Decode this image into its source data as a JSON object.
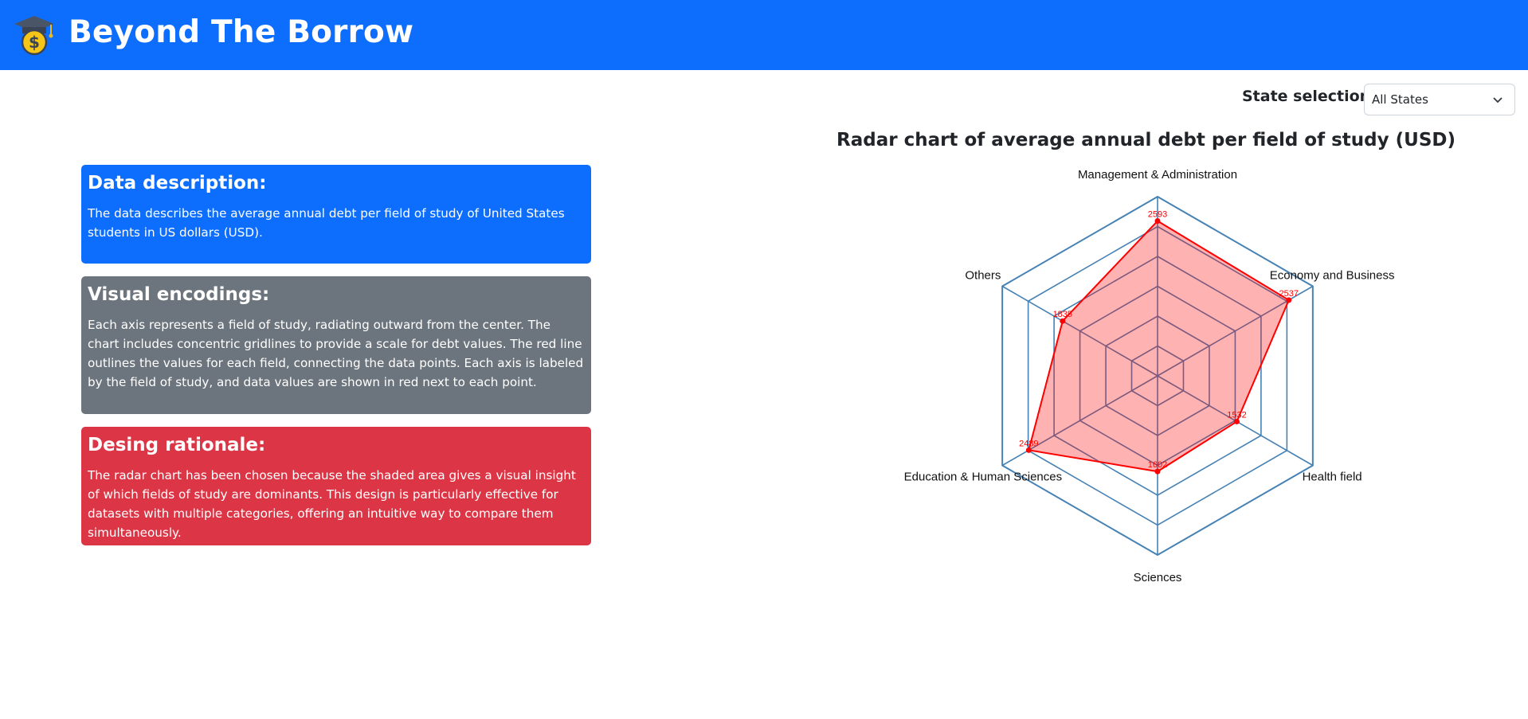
{
  "app": {
    "title": "Beyond The Borrow",
    "logo_icon": "graduation-cap-coin-icon"
  },
  "state_selector": {
    "label": "State selection:",
    "value": "All States"
  },
  "cards": {
    "description": {
      "title": "Data description:",
      "text": "The data describes the average annual debt per field of study of United States students in US dollars (USD).",
      "color": "#0d6efd"
    },
    "encodings": {
      "title": "Visual encodings:",
      "text": "Each axis represents a field of study, radiating outward from the center. The chart includes concentric gridlines to provide a scale for debt values. The red line outlines the values for each field, connecting the data points. Each axis is labeled by the field of study, and data values are shown in red next to each point.",
      "color": "#6c757d"
    },
    "rationale": {
      "title": "Desing rationale:",
      "text": "The radar chart has been chosen because the shaded area gives a visual insight of which fields of study are dominants. This design is particularly effective for datasets with multiple categories, offering an intuitive way to compare them simultaneously.",
      "color": "#dc3545"
    }
  },
  "chart_data": {
    "type": "radar",
    "title": "Radar chart of average annual debt per field of study (USD)",
    "categories": [
      "Management & Administration",
      "Economy and Business",
      "Health field",
      "Sciences",
      "Education & Human Sciences",
      "Others"
    ],
    "values": [
      2593,
      2537,
      1532,
      1602,
      2489,
      1835
    ],
    "rmax": 3000,
    "grid_levels": 6,
    "colors": {
      "line": "#ff0000",
      "fill": "rgba(255,0,0,0.3)",
      "grid": "#4682b4",
      "labels": "#ff0000"
    }
  }
}
